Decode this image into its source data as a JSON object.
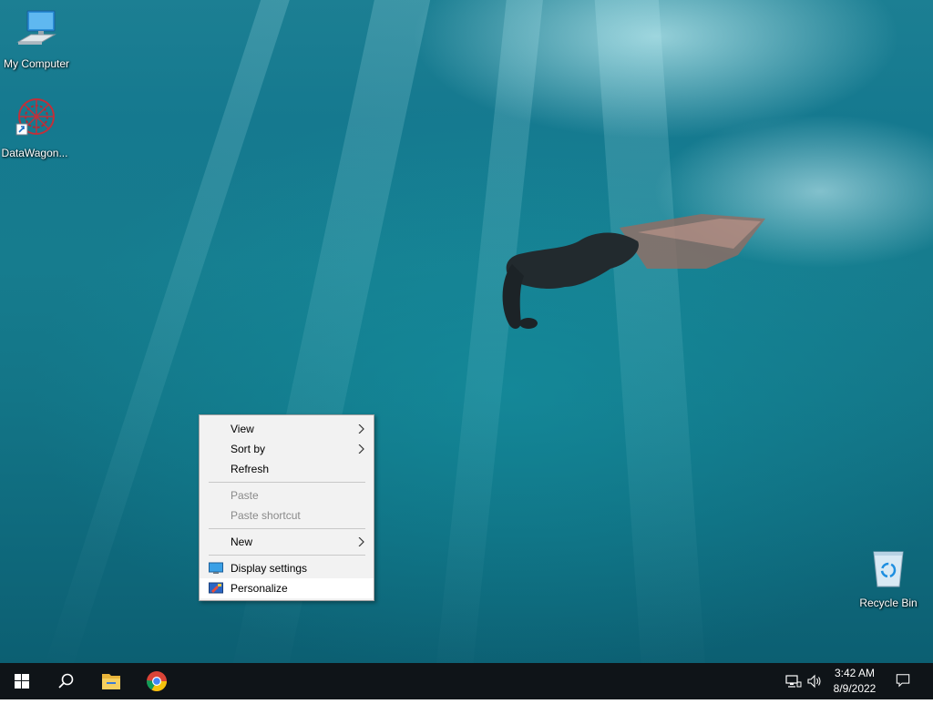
{
  "desktop": {
    "icons": [
      {
        "label": "My Computer"
      },
      {
        "label": "DataWagon..."
      },
      {
        "label": "Recycle Bin"
      }
    ]
  },
  "context_menu": {
    "items": [
      {
        "label": "View",
        "enabled": true,
        "submenu": true
      },
      {
        "label": "Sort by",
        "enabled": true,
        "submenu": true
      },
      {
        "label": "Refresh",
        "enabled": true,
        "submenu": false
      },
      {
        "label": "Paste",
        "enabled": false,
        "submenu": false
      },
      {
        "label": "Paste shortcut",
        "enabled": false,
        "submenu": false
      },
      {
        "label": "New",
        "enabled": true,
        "submenu": true
      },
      {
        "label": "Display settings",
        "enabled": true,
        "icon": "display-icon"
      },
      {
        "label": "Personalize",
        "enabled": true,
        "icon": "personalize-icon",
        "highlighted": true
      }
    ]
  },
  "taskbar": {
    "pinned": [
      "start-icon",
      "search-icon",
      "file-explorer-icon",
      "chrome-icon"
    ],
    "tray": [
      "network-icon",
      "volume-icon"
    ],
    "clock": {
      "time": "3:42 AM",
      "date": "8/9/2022"
    },
    "notification_icon": "action-center-icon"
  },
  "colors": {
    "taskbar": "#0f1418",
    "menu_bg": "#f2f2f2",
    "menu_disabled_text": "#8a8a8a"
  }
}
